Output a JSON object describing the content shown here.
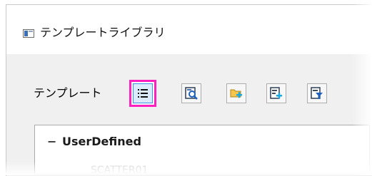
{
  "window": {
    "title": "テンプレートライブラリ",
    "title_icon": "window-app-icon"
  },
  "toolbar": {
    "label": "テンプレート",
    "buttons": [
      {
        "icon": "list-view-icon",
        "selected": true,
        "highlight_color": "#ff1fbf"
      },
      {
        "icon": "preview-icon",
        "selected": false
      },
      {
        "icon": "add-folder-icon",
        "selected": false
      },
      {
        "icon": "add-template-icon",
        "selected": false
      },
      {
        "icon": "filter-icon",
        "selected": false
      }
    ]
  },
  "tree": {
    "expand_symbol": "−",
    "group_label": "UserDefined",
    "items": [
      "SCATTER01"
    ]
  }
}
